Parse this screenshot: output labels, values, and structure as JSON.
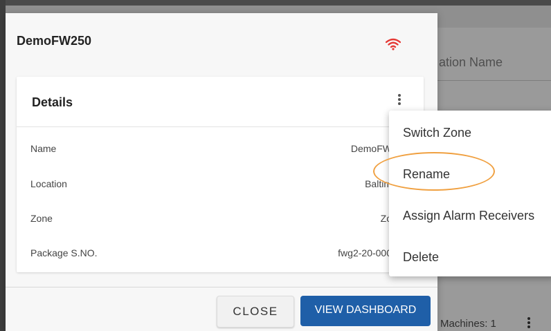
{
  "background": {
    "column_header": "ation Name",
    "machines_text": "Machines: 1"
  },
  "dialog": {
    "title": "DemoFW250",
    "status_icon": "wifi-icon",
    "status_color": "#e53935",
    "details": {
      "title": "Details",
      "rows": [
        {
          "label": "Name",
          "value": "DemoFW"
        },
        {
          "label": "Location",
          "value": "Baltim"
        },
        {
          "label": "Zone",
          "value": "Zo"
        },
        {
          "label": "Package S.NO.",
          "value": "fwg2-20-000"
        }
      ]
    },
    "buttons": {
      "close": "CLOSE",
      "view_dashboard": "VIEW DASHBOARD"
    },
    "accent_color": "#1f5fa8"
  },
  "context_menu": {
    "items": [
      {
        "label": "Switch Zone"
      },
      {
        "label": "Rename"
      },
      {
        "label": "Assign Alarm Receivers"
      },
      {
        "label": "Delete"
      }
    ],
    "highlighted": "Rename",
    "highlight_color": "#f0a040"
  }
}
